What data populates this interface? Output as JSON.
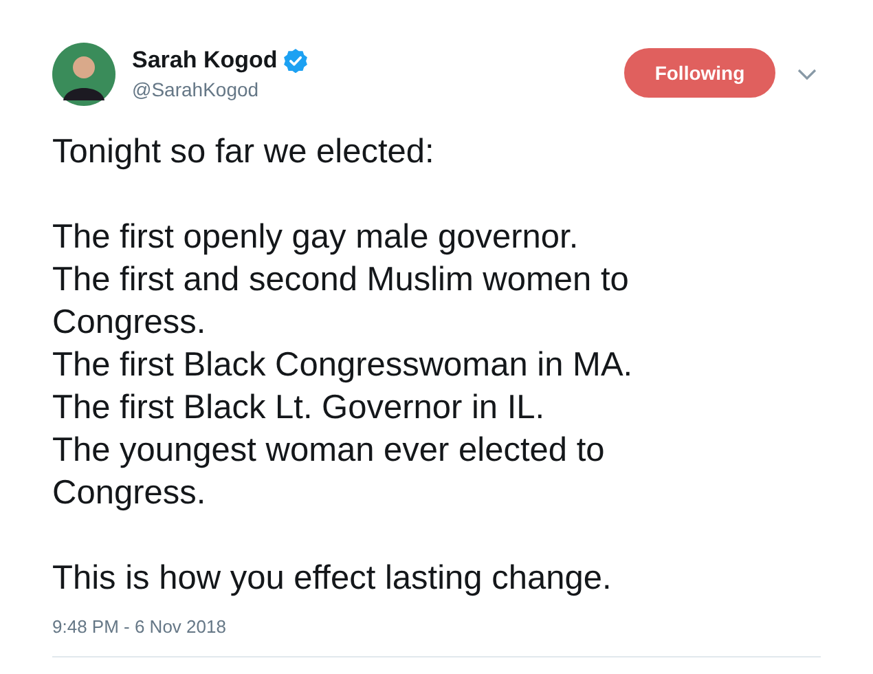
{
  "author": {
    "name": "Sarah Kogod",
    "verified": true,
    "handle": "@SarahKogod"
  },
  "follow_button": {
    "label": "Following",
    "following": true
  },
  "tweet": {
    "paragraphs": [
      [
        "Tonight so far we elected:"
      ],
      [
        "The first openly gay male governor.",
        "The first and second Muslim women to",
        "Congress.",
        "The first Black Congresswoman in MA.",
        "The first Black Lt. Governor in IL.",
        "The youngest woman ever elected to",
        "Congress."
      ],
      [
        "This is how you effect lasting change."
      ]
    ]
  },
  "timestamp": "9:48 PM - 6 Nov 2018"
}
